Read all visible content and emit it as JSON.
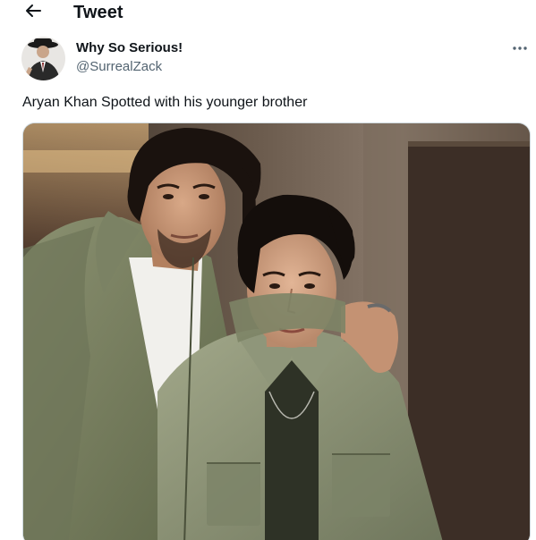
{
  "header": {
    "title": "Tweet",
    "back_icon": "arrow-left-icon"
  },
  "author": {
    "display_name": "Why So Serious!",
    "handle": "@SurrealZack",
    "avatar_icon": "avatar-image"
  },
  "tweet": {
    "text": "Aryan Khan Spotted with his younger brother",
    "more_icon": "more-dots-icon",
    "media_icon": "photo-image"
  },
  "colors": {
    "text_primary": "#0f1419",
    "text_secondary": "#536471",
    "border": "#cfd9de"
  }
}
